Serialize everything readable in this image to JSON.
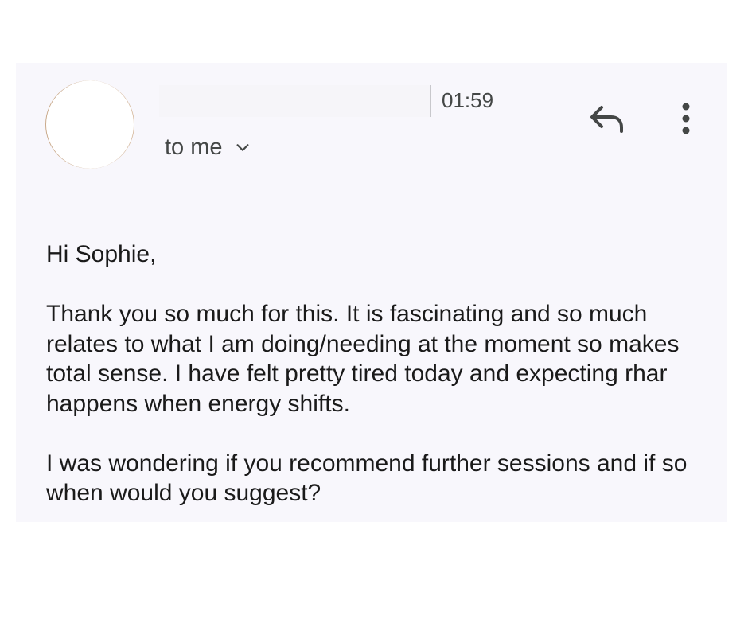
{
  "header": {
    "time": "01:59",
    "recipient_label": "to me"
  },
  "icons": {
    "reply": "reply-icon",
    "more": "more-vert-icon",
    "expand": "chevron-down-icon"
  },
  "message": {
    "greeting": "Hi Sophie,",
    "paragraphs": [
      "Thank you so much for this. It is fascinating and so much relates to what I am doing/needing at the moment so makes total sense. I have felt pretty tired today and expecting rhar happens when energy shifts.",
      "I was wondering if you recommend further sessions and if so when would you suggest?"
    ]
  },
  "colors": {
    "card_background": "#f8f7fc",
    "secondary_text": "#444746"
  }
}
